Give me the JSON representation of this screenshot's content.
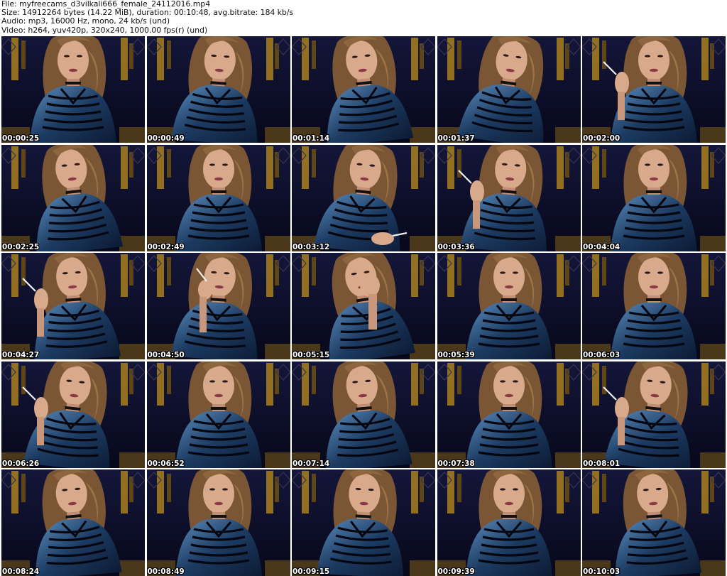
{
  "header": {
    "file_line": "File: myfreecams_d3vilkali666_female_24112016.mp4",
    "size_line": "Size: 14912264 bytes (14.22 MiB), duration: 00:10:48, avg.bitrate: 184 kb/s",
    "audio_line": "Audio: mp3, 16000 Hz, mono, 24 kb/s (und)",
    "video_line": "Video: h264, yuv420p, 320x240, 1000.00 fps(r) (und)"
  },
  "frames": [
    {
      "time": "00:00:25",
      "tilt": 0,
      "hand": "none"
    },
    {
      "time": "00:00:49",
      "tilt": 4,
      "hand": "none"
    },
    {
      "time": "00:01:14",
      "tilt": -6,
      "hand": "none"
    },
    {
      "time": "00:01:37",
      "tilt": 8,
      "hand": "none"
    },
    {
      "time": "00:02:00",
      "tilt": 0,
      "hand": "left-cigarette"
    },
    {
      "time": "00:02:25",
      "tilt": -6,
      "hand": "none"
    },
    {
      "time": "00:02:49",
      "tilt": 0,
      "hand": "none"
    },
    {
      "time": "00:03:12",
      "tilt": 6,
      "hand": "low-cigarette"
    },
    {
      "time": "00:03:36",
      "tilt": 5,
      "hand": "left-cigarette"
    },
    {
      "time": "00:04:04",
      "tilt": 0,
      "hand": "none"
    },
    {
      "time": "00:04:27",
      "tilt": -4,
      "hand": "left-cigarette"
    },
    {
      "time": "00:04:50",
      "tilt": 4,
      "hand": "face-cigarette"
    },
    {
      "time": "00:05:15",
      "tilt": -8,
      "hand": "face"
    },
    {
      "time": "00:05:39",
      "tilt": 0,
      "hand": "none"
    },
    {
      "time": "00:06:03",
      "tilt": 0,
      "hand": "none"
    },
    {
      "time": "00:06:26",
      "tilt": 6,
      "hand": "left-cigarette"
    },
    {
      "time": "00:06:52",
      "tilt": 0,
      "hand": "none"
    },
    {
      "time": "00:07:14",
      "tilt": -5,
      "hand": "none"
    },
    {
      "time": "00:07:38",
      "tilt": 0,
      "hand": "none"
    },
    {
      "time": "00:08:01",
      "tilt": 6,
      "hand": "left-cigarette"
    },
    {
      "time": "00:08:24",
      "tilt": -5,
      "hand": "none"
    },
    {
      "time": "00:08:49",
      "tilt": 0,
      "hand": "none"
    },
    {
      "time": "00:09:15",
      "tilt": 3,
      "hand": "none"
    },
    {
      "time": "00:09:39",
      "tilt": 0,
      "hand": "none"
    },
    {
      "time": "00:10:03",
      "tilt": -4,
      "hand": "none"
    }
  ],
  "colors": {
    "background": "#ffffff",
    "scene_dark": "#0b0d26",
    "throne_gold": "#a9801e",
    "outfit_blue": "#1c3b62",
    "outfit_highlight": "#5d8fc0",
    "hair": "#7a5634",
    "skin": "#d9a98c"
  },
  "icons": {
    "thumbnail": "video-frame-thumbnail"
  }
}
